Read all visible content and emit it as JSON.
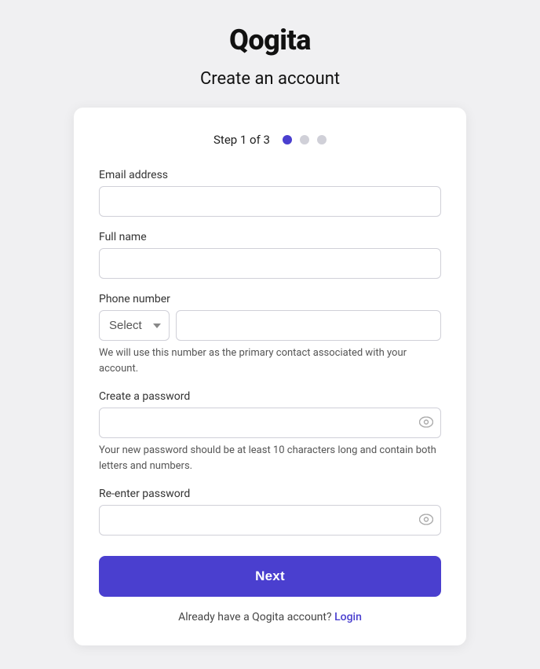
{
  "app": {
    "title": "Qogita"
  },
  "page": {
    "title": "Create an account"
  },
  "step": {
    "label": "Step 1 of 3",
    "dots": [
      {
        "active": true
      },
      {
        "active": false
      },
      {
        "active": false
      }
    ]
  },
  "form": {
    "email_label": "Email address",
    "email_placeholder": "",
    "fullname_label": "Full name",
    "fullname_placeholder": "",
    "phone_label": "Phone number",
    "phone_select_label": "Select",
    "phone_hint": "We will use this number as the primary contact associated with your account.",
    "password_label": "Create a password",
    "password_hint": "Your new password should be at least 10 characters long and contain both letters and numbers.",
    "repassword_label": "Re-enter password"
  },
  "buttons": {
    "next": "Next"
  },
  "footer": {
    "login_prompt": "Already have a Qogita account?",
    "login_link": "Login"
  }
}
